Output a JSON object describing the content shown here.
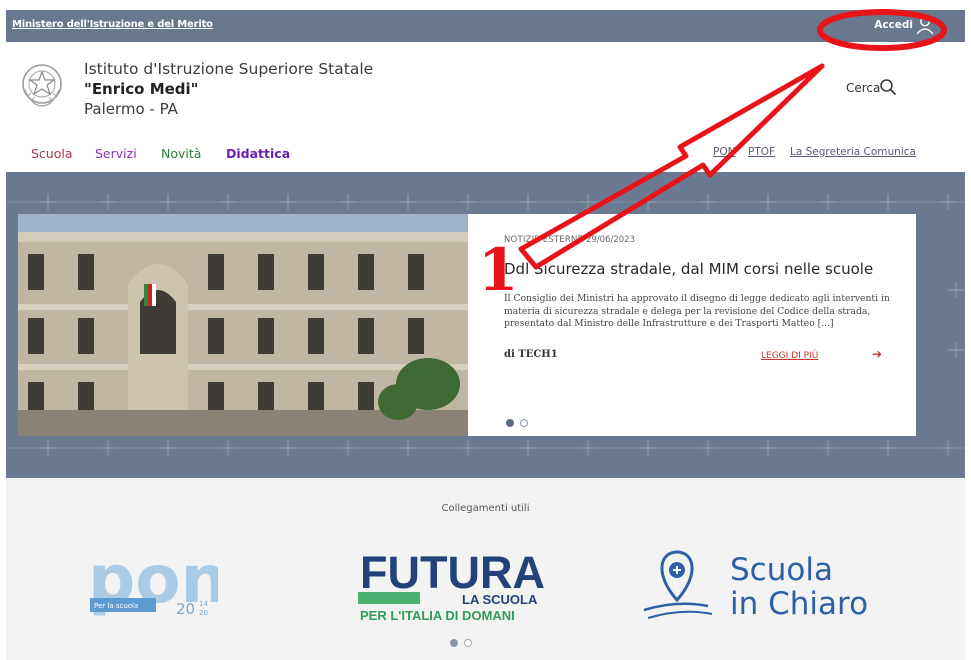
{
  "topbar": {
    "ministry_link": "Ministero dell'Istruzione e del Merito",
    "login_label": "Accedi",
    "login_icon": "user-icon"
  },
  "header": {
    "institute_type": "Istituto d'Istruzione Superiore Statale",
    "institute_name": "\"Enrico Medi\"",
    "location": "Palermo - PA",
    "search_label": "Cerca",
    "search_icon": "search-icon"
  },
  "nav": {
    "items": [
      {
        "label": "Scuola",
        "color": "#a2384a"
      },
      {
        "label": "Servizi",
        "color": "#8b2db8"
      },
      {
        "label": "Novità",
        "color": "#2f7d3a"
      },
      {
        "label": "Didattica",
        "color": "#6a1fb5"
      }
    ],
    "quick_links": [
      "PON",
      "PTOF",
      "La Segreteria Comunica"
    ]
  },
  "hero": {
    "category": "NOTIZIE ESTERNE",
    "date": "29/06/2023",
    "title": "Ddl Sicurezza stradale, dal MIM corsi nelle scuole",
    "body": "Il Consiglio dei Ministri ha approvato il disegno di legge dedicato agli interventi in materia di sicurezza stradale e delega per la revisione del Codice della strada, presentato dal Ministro delle Infrastrutture e dei Trasporti Matteo [...]",
    "author": "di TECH1",
    "read_more": "LEGGI DI PIÙ",
    "read_more_icon": "arrow-right-icon",
    "carousel_active": 1,
    "carousel_total": 2
  },
  "annotation": {
    "number": "1",
    "color": "#e8141a"
  },
  "useful_links": {
    "heading": "Collegamenti utili",
    "pon": {
      "main": "pon",
      "sub": "Per la scuola",
      "year1": "20",
      "year2": "14",
      "year3": "20"
    },
    "futura": {
      "main": "FUTURA",
      "line2": "LA SCUOLA",
      "line3": "PER L'ITALIA DI DOMANI"
    },
    "scuola_in_chiaro": {
      "line1": "Scuola",
      "line2": "in Chiaro"
    },
    "carousel_active": 1,
    "carousel_total": 2
  },
  "colors": {
    "topbar": "#69788e",
    "hero_bg": "#6b7a90",
    "accent_red": "#c0392b",
    "annotation_red": "#e8141a"
  }
}
